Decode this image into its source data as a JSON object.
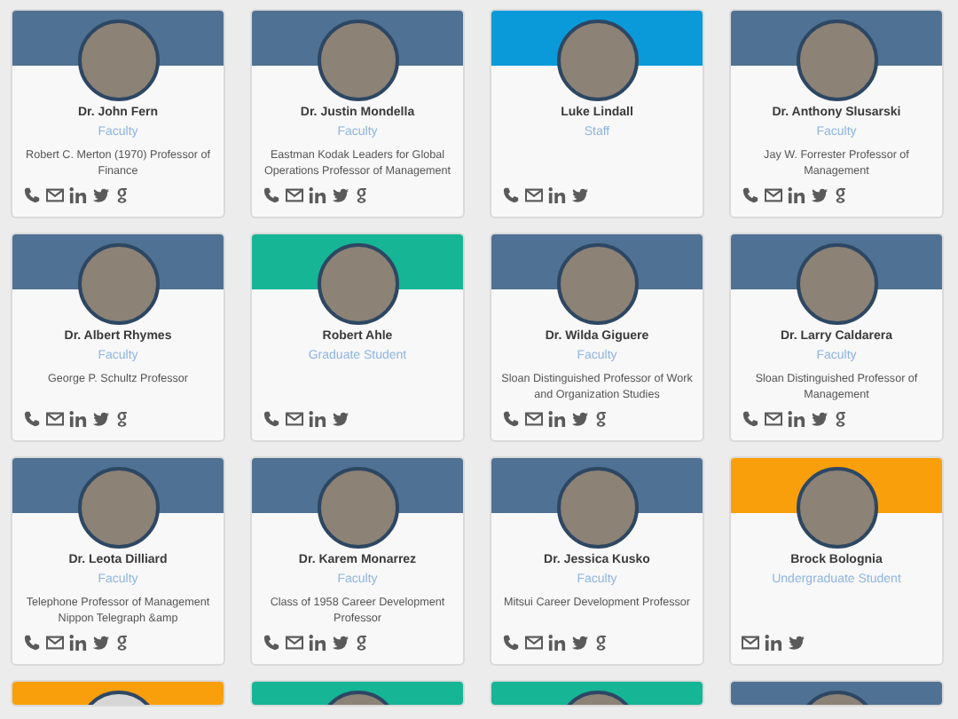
{
  "people": [
    {
      "name": "Dr. John Fern",
      "role": "Faculty",
      "title": "Robert C. Merton (1970) Professor of Finance",
      "color": "#4f7193",
      "contacts": [
        {
          "kind": "phone"
        },
        {
          "kind": "email"
        },
        {
          "kind": "linkedin"
        },
        {
          "kind": "twitter"
        },
        {
          "kind": "google"
        }
      ]
    },
    {
      "name": "Dr. Justin Mondella",
      "role": "Faculty",
      "title": "Eastman Kodak Leaders for Global Operations Professor of Management",
      "color": "#4f7193",
      "contacts": [
        {
          "kind": "phone"
        },
        {
          "kind": "email"
        },
        {
          "kind": "linkedin"
        },
        {
          "kind": "twitter"
        },
        {
          "kind": "google"
        }
      ]
    },
    {
      "name": "Luke Lindall",
      "role": "Staff",
      "color": "#0a9ad9",
      "contacts": [
        {
          "kind": "phone"
        },
        {
          "kind": "email"
        },
        {
          "kind": "linkedin"
        },
        {
          "kind": "twitter"
        }
      ]
    },
    {
      "name": "Dr. Anthony Slusarski",
      "role": "Faculty",
      "title": "Jay W. Forrester Professor of Management",
      "color": "#4f7193",
      "contacts": [
        {
          "kind": "phone"
        },
        {
          "kind": "email"
        },
        {
          "kind": "linkedin"
        },
        {
          "kind": "twitter"
        },
        {
          "kind": "google"
        }
      ]
    },
    {
      "name": "Dr. Albert Rhymes",
      "role": "Faculty",
      "title": "George P. Schultz Professor",
      "color": "#4f7193",
      "contacts": [
        {
          "kind": "phone"
        },
        {
          "kind": "email"
        },
        {
          "kind": "linkedin"
        },
        {
          "kind": "twitter"
        },
        {
          "kind": "google"
        }
      ]
    },
    {
      "name": "Robert Ahle",
      "role": "Graduate Student",
      "color": "#15b595",
      "contacts": [
        {
          "kind": "phone"
        },
        {
          "kind": "email"
        },
        {
          "kind": "linkedin"
        },
        {
          "kind": "twitter"
        }
      ]
    },
    {
      "name": "Dr. Wilda Giguere",
      "role": "Faculty",
      "title": "Sloan Distinguished Professor of Work and Organization Studies",
      "color": "#4f7193",
      "contacts": [
        {
          "kind": "phone"
        },
        {
          "kind": "email"
        },
        {
          "kind": "linkedin"
        },
        {
          "kind": "twitter"
        },
        {
          "kind": "google"
        }
      ]
    },
    {
      "name": "Dr. Larry Caldarera",
      "role": "Faculty",
      "title": "Sloan Distinguished Professor of Management",
      "color": "#4f7193",
      "contacts": [
        {
          "kind": "phone"
        },
        {
          "kind": "email"
        },
        {
          "kind": "linkedin"
        },
        {
          "kind": "twitter"
        },
        {
          "kind": "google"
        }
      ]
    },
    {
      "name": "Dr. Leota Dilliard",
      "role": "Faculty",
      "title": "Telephone Professor of Management Nippon Telegraph &amp",
      "color": "#4f7193",
      "contacts": [
        {
          "kind": "phone"
        },
        {
          "kind": "email"
        },
        {
          "kind": "linkedin"
        },
        {
          "kind": "twitter"
        },
        {
          "kind": "google"
        }
      ]
    },
    {
      "name": "Dr. Karem Monarrez",
      "role": "Faculty",
      "title": "Class of 1958 Career Development Professor",
      "color": "#4f7193",
      "contacts": [
        {
          "kind": "phone"
        },
        {
          "kind": "email"
        },
        {
          "kind": "linkedin"
        },
        {
          "kind": "twitter"
        },
        {
          "kind": "google"
        }
      ]
    },
    {
      "name": "Dr. Jessica Kusko",
      "role": "Faculty",
      "title": "Mitsui Career Development Professor",
      "color": "#4f7193",
      "contacts": [
        {
          "kind": "phone"
        },
        {
          "kind": "email"
        },
        {
          "kind": "linkedin"
        },
        {
          "kind": "twitter"
        },
        {
          "kind": "google"
        }
      ]
    },
    {
      "name": "Brock Bolognia",
      "role": "Undergraduate Student",
      "color": "#f99f0b",
      "contacts": [
        {
          "kind": "email"
        },
        {
          "kind": "linkedin"
        },
        {
          "kind": "twitter"
        }
      ]
    },
    {
      "color": "#f99f0b",
      "silhouette": true
    },
    {
      "color": "#15b595"
    },
    {
      "color": "#15b595"
    },
    {
      "color": "#4f7193"
    }
  ]
}
